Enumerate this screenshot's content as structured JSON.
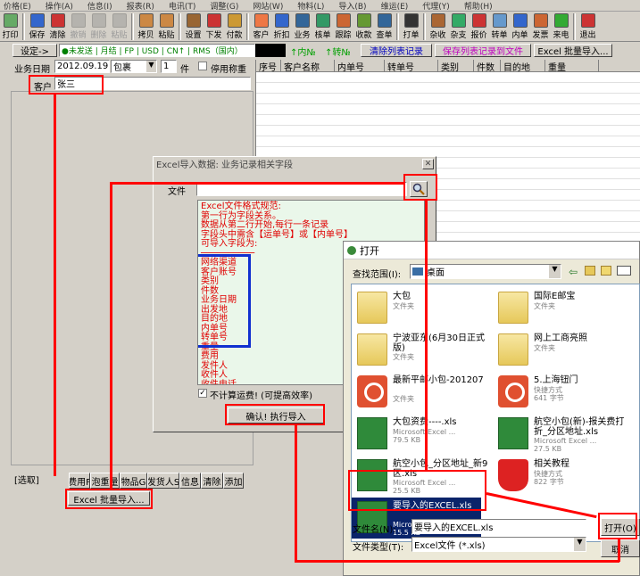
{
  "menubar": [
    "价格(E)",
    "操作(A)",
    "信息(I)",
    "报表(R)",
    "电讯(T)",
    "调整(G)",
    "网站(W)",
    "物料(L)",
    "导入(B)",
    "维运(E)",
    "代理(Y)",
    "帮助(H)"
  ],
  "toolbar": [
    "打印",
    "保存",
    "清除",
    "撤销",
    "删除",
    "粘贴",
    "拷贝",
    "粘贴",
    "设置",
    "下发",
    "付款",
    "客户",
    "折扣",
    "业务",
    "核单",
    "跟踪",
    "收款",
    "查单",
    "打单",
    "杂收",
    "杂支",
    "报价",
    "转单",
    "内单",
    "发票",
    "来电",
    "退出"
  ],
  "row2": {
    "settings": "设定->",
    "status_text": "●未发送 | 月结 | FP | USD | CN↑ | RMS（国内）",
    "in_no": "↑内№",
    "out_no": "↑转№",
    "clear_list": "清除列表记录",
    "save_list": "保存列表记录到文件",
    "excel_import": "Excel 批量导入..."
  },
  "form": {
    "date_label": "业务日期",
    "date_value": "2012.09.19",
    "pack_value": "包裹",
    "count_value": "1",
    "count_unit": "件",
    "stop_weigh": "停用称重",
    "customer_label": "客户",
    "customer_value": "张三"
  },
  "grid": {
    "headers": [
      "序号",
      "客户名称",
      "内单号",
      "转单号",
      "类别",
      "件数",
      "目的地",
      "重量"
    ]
  },
  "bottom": {
    "select_label": "[选取]",
    "tabs": [
      "费用F",
      "泡重量",
      "物品G",
      "发货人S",
      "信息",
      "清除",
      "添加"
    ],
    "excel_import": "Excel 批量导入..."
  },
  "import_dialog": {
    "title": "Excel导入数据: 业务记录相关字段",
    "file_label": "文件",
    "file_value": "",
    "spec_lines": [
      "Excel文件格式规范:",
      "第一行为字段关系。",
      "数据从第二行开始,每行一条记录",
      "字段头中需含【运单号】或【内单号】",
      "可导入字段为:",
      "──────────",
      "网络渠道",
      "客户账号",
      "类别",
      "件数",
      "业务日期",
      "出发地",
      "目的地",
      "内单号",
      "转单号",
      "重量",
      "费用",
      "发件人",
      "收件人",
      "收件电话"
    ],
    "no_freight": "不计算运费! (可提高效率)",
    "confirm": "确认! 执行导入"
  },
  "open_dialog": {
    "title": "打开",
    "lookin_label": "查找范围(I):",
    "lookin_value": "桌面",
    "files": [
      {
        "name": "大包",
        "sub": [
          "文件夹"
        ],
        "icon": "folder-icon"
      },
      {
        "name": "国际E邮宝",
        "sub": [
          "文件夹"
        ],
        "icon": "folder-icon"
      },
      {
        "name": "宁波亚东(6月30日正式版)",
        "sub": [
          "文件夹"
        ],
        "icon": "folder-icon"
      },
      {
        "name": "网上工商亮照",
        "sub": [
          "文件夹"
        ],
        "icon": "folder-icon"
      },
      {
        "name": "最新平邮小包-201207",
        "sub": [
          "文件夹"
        ],
        "icon": "power-icon"
      },
      {
        "name": "5.上海钮门",
        "sub": [
          "快捷方式",
          "641 字节"
        ],
        "icon": "power-icon"
      },
      {
        "name": "大包资费----.xls",
        "sub": [
          "Microsoft Excel ...",
          "79.5 KB"
        ],
        "icon": "excel-icon"
      },
      {
        "name": "航空小包(新)-报关费打折_分区地址.xls",
        "sub": [
          "Microsoft Excel ...",
          "27.5 KB"
        ],
        "icon": "excel-icon"
      },
      {
        "name": "航空小包_分区地址_新9区.xls",
        "sub": [
          "Microsoft Excel ...",
          "25.5 KB"
        ],
        "icon": "excel-icon"
      },
      {
        "name": "相关教程",
        "sub": [
          "快捷方式",
          "822 字节"
        ],
        "icon": "shield-icon"
      },
      {
        "name": "要导入的EXCEL.xls",
        "sub": [
          "Microsoft Excel ...",
          "15.5 KB"
        ],
        "icon": "excel-icon"
      }
    ],
    "filename_label": "文件名(N):",
    "filename_value": "要导入的EXCEL.xls",
    "filetype_label": "文件类型(T):",
    "filetype_value": "Excel文件 (*.xls)",
    "open_btn": "打开(O)",
    "cancel_btn": "取消"
  }
}
